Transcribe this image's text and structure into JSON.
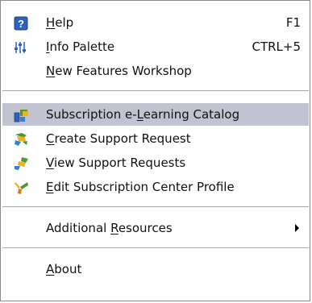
{
  "menu": {
    "items": [
      {
        "pre": "",
        "u": "H",
        "post": "elp",
        "shortcut": "F1",
        "icon": "help-icon"
      },
      {
        "pre": "",
        "u": "I",
        "post": "nfo Palette",
        "shortcut": "CTRL+5",
        "icon": "info-palette-icon"
      },
      {
        "pre": "",
        "u": "N",
        "post": "ew Features Workshop",
        "shortcut": "",
        "icon": ""
      },
      {
        "pre": "Subscription e-",
        "u": "L",
        "post": "earning Catalog",
        "shortcut": "",
        "icon": "elearning-catalog-icon"
      },
      {
        "pre": "",
        "u": "C",
        "post": "reate Support Request",
        "shortcut": "",
        "icon": "create-support-request-icon"
      },
      {
        "pre": "",
        "u": "V",
        "post": "iew Support Requests",
        "shortcut": "",
        "icon": "view-support-requests-icon"
      },
      {
        "pre": "",
        "u": "E",
        "post": "dit Subscription Center Profile",
        "shortcut": "",
        "icon": "edit-profile-icon"
      },
      {
        "pre": "Additional ",
        "u": "R",
        "post": "esources",
        "shortcut": "",
        "icon": "submenu-arrow-icon"
      },
      {
        "pre": "",
        "u": "A",
        "post": "bout",
        "shortcut": "",
        "icon": ""
      }
    ]
  },
  "colors": {
    "highlight": "#c1c4d0",
    "help_blue": "#2f63b8",
    "green": "#4e9a2b",
    "yellow": "#e8b22a"
  }
}
